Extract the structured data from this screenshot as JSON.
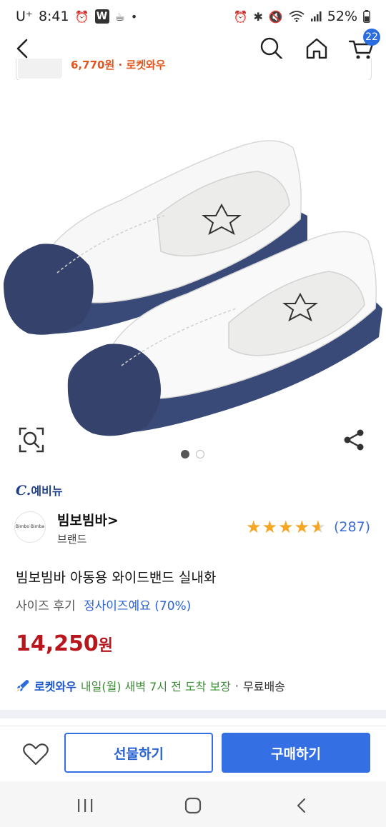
{
  "status_bar": {
    "carrier": "U⁺",
    "time": "8:41",
    "left_icons": [
      "alarm-icon",
      "w-app-icon",
      "cup-icon",
      "dot-icon"
    ],
    "w_label": "W",
    "right_icons": [
      "alarm-icon",
      "bluetooth-icon",
      "mute-icon",
      "wifi-icon",
      "signal-icon"
    ],
    "battery": "52%"
  },
  "nav": {
    "icons": [
      "back-arrow-icon",
      "search-icon",
      "home-icon",
      "cart-icon"
    ],
    "cart_count": "22"
  },
  "mini_card": {
    "price_text": "6,770원 · 로켓와우"
  },
  "product_image": {
    "alt": "",
    "pagination": {
      "total": 2,
      "active": 1
    }
  },
  "category": {
    "prefix": "C.",
    "name": "예비뉴"
  },
  "brand": {
    "logo_text": "Bimbo Bimba",
    "name": "빔보빔바",
    "chevron": ">",
    "sub": "브랜드"
  },
  "rating": {
    "stars": 4.5,
    "count": "(287)"
  },
  "product": {
    "title": "빔보빔바 아동용 와이드밴드 실내화",
    "size_review_label": "사이즈 후기",
    "size_review_value": "정사이즈예요 (70%)",
    "price_number": "14,250",
    "price_unit": "원"
  },
  "delivery": {
    "badge": "로켓와우",
    "text": "내일(월) 새벽 7시 전 도착 보장",
    "separator": "·",
    "free": "무료배송"
  },
  "actions": {
    "gift": "선물하기",
    "buy": "구매하기"
  },
  "colors": {
    "accent": "#3470e4",
    "price": "#b8161c",
    "rocket": "#1e58c8",
    "delivery_green": "#3d8c35",
    "star": "#f5a623"
  }
}
